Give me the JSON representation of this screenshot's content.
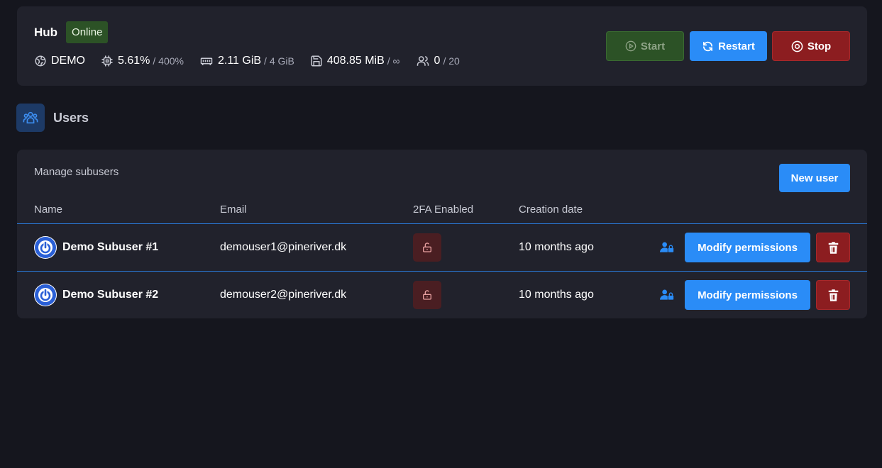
{
  "colors": {
    "background": "#15161e",
    "card": "#21222c",
    "accent": "#2a8cf7",
    "online_badge": "#2c5226",
    "danger": "#8c1d20"
  },
  "server": {
    "name": "Hub",
    "status": "Online",
    "location": "DEMO",
    "cpu": "5.61%",
    "cpu_limit": "/ 400%",
    "memory": "2.11 GiB",
    "memory_limit": "/ 4 GiB",
    "disk": "408.85 MiB",
    "disk_limit": "/ ∞",
    "players": "0",
    "players_limit": "/ 20",
    "buttons": {
      "start": "Start",
      "restart": "Restart",
      "stop": "Stop"
    }
  },
  "page": {
    "title": "Users",
    "icon": "users-icon"
  },
  "users_panel": {
    "title": "Manage subusers",
    "new_user_label": "New user",
    "columns": [
      "Name",
      "Email",
      "2FA Enabled",
      "Creation date"
    ],
    "rows": [
      {
        "name": "Demo Subuser #1",
        "email": "demouser1@pineriver.dk",
        "two_fa_icon": "unlock-icon",
        "created": "10 months ago",
        "modify_label": "Modify permissions"
      },
      {
        "name": "Demo Subuser #2",
        "email": "demouser2@pineriver.dk",
        "two_fa_icon": "unlock-icon",
        "created": "10 months ago",
        "modify_label": "Modify permissions"
      }
    ]
  }
}
